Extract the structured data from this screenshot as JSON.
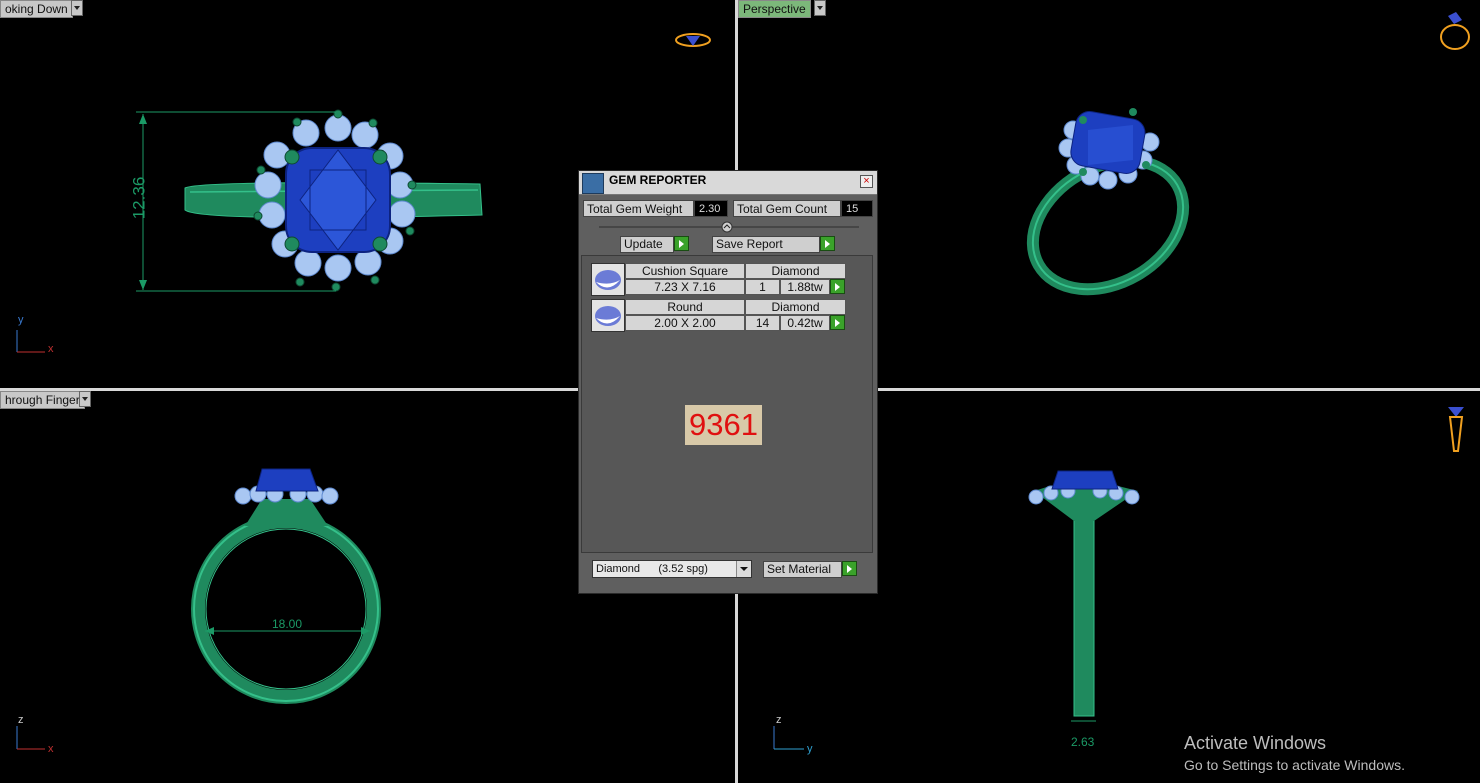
{
  "viewports": {
    "top_left": {
      "label": "oking Down",
      "axis_v": "y",
      "axis_h": "x",
      "dimension": "12.36"
    },
    "top_right": {
      "label": "Perspective"
    },
    "bottom_left": {
      "label": "hrough Finger",
      "axis_v": "z",
      "axis_h": "x",
      "dimension": "18.00"
    },
    "bottom_right": {
      "axis_v": "z",
      "axis_h": "y",
      "dimension": "2.63"
    }
  },
  "gem_reporter": {
    "title": "GEM REPORTER",
    "close_icon": "close-icon",
    "total_weight_label": "Total Gem Weight",
    "total_weight_value": "2.30",
    "total_count_label": "Total Gem Count",
    "total_count_value": "15",
    "update_label": "Update",
    "save_report_label": "Save Report",
    "gems": [
      {
        "shape": "Cushion Square",
        "material": "Diamond",
        "size": "7.23 X 7.16",
        "count": "1",
        "weight": "1.88tw"
      },
      {
        "shape": "Round",
        "material": "Diamond",
        "size": "2.00 X 2.00",
        "count": "14",
        "weight": "0.42tw"
      }
    ],
    "stamp": "9361",
    "material_select": "Diamond      (3.52 spg)",
    "set_material_label": "Set Material"
  },
  "watermark": {
    "line1": "Activate Windows",
    "line2": "Go to Settings to activate Windows."
  },
  "colors": {
    "metal": "#1f8a5e",
    "metal_light": "#34c08a",
    "center_stone": "#1d3fc0",
    "side_stone": "#a9c7f2",
    "dimension": "#1b9a66",
    "stamp_red": "#e01010",
    "stamp_bg": "#d8c9a8"
  }
}
